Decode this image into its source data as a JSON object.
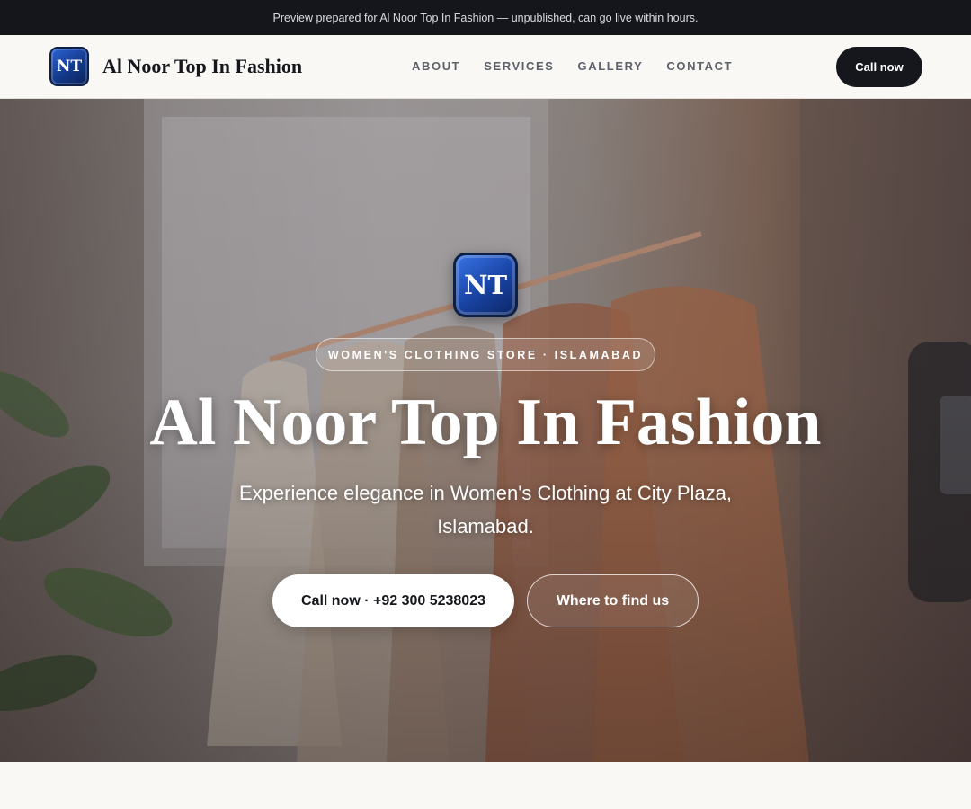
{
  "preview_banner": {
    "text": "Preview prepared for Al Noor Top In Fashion — unpublished, can go live within hours."
  },
  "header": {
    "logo_text": "NT",
    "brand_name": "Al Noor Top In Fashion",
    "nav": [
      {
        "label": "ABOUT"
      },
      {
        "label": "SERVICES"
      },
      {
        "label": "GALLERY"
      },
      {
        "label": "CONTACT"
      }
    ],
    "call_label": "Call now"
  },
  "hero": {
    "logo_text": "NT",
    "tag": "WOMEN'S CLOTHING STORE · ISLAMABAD",
    "title": "Al Noor Top In Fashion",
    "subtitle": "Experience elegance in Women's Clothing at City Plaza, Islamabad.",
    "primary_button": "Call now · +92 300 5238023",
    "secondary_button": "Where to find us",
    "background_image": "clothing-rack-photo"
  },
  "colors": {
    "preview_bar": "#14161b",
    "header_bg": "#f9f8f5",
    "dark_button": "#15171c",
    "logo_blue": "#1a46a8",
    "nav_text": "#5c606a"
  }
}
